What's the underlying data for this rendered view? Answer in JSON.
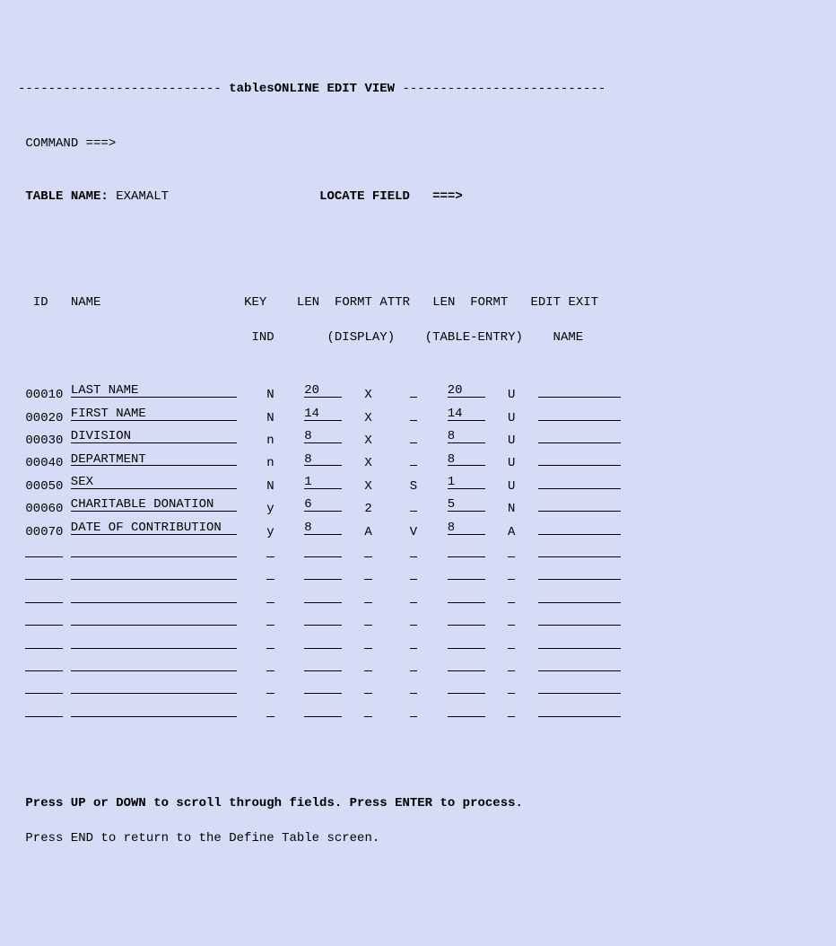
{
  "title_dashes_left": "--------------------------- ",
  "title": "tablesONLINE EDIT VIEW",
  "title_dashes_right": " ---------------------------",
  "command_label": "COMMAND ===>",
  "command_value": "",
  "table_name_label": "TABLE NAME:",
  "table_name_value": "EXAMALT",
  "locate_label": "LOCATE FIELD",
  "locate_arrow": "===>",
  "locate_value": "",
  "headers": {
    "id": "ID",
    "name": "NAME",
    "key": "KEY",
    "ind": "IND",
    "len1": "LEN",
    "formt1": "FORMT",
    "attr": "ATTR",
    "display": "(DISPLAY)",
    "len2": "LEN",
    "formt2": "FORMT",
    "table_entry": "(TABLE-ENTRY)",
    "edit_exit": "EDIT EXIT",
    "edit_name": "NAME"
  },
  "rows": [
    {
      "id": "00010",
      "name": "LAST NAME",
      "key": "N",
      "len1": "20",
      "formt1": "X",
      "attr": "",
      "len2": "20",
      "formt2": "U",
      "edit": ""
    },
    {
      "id": "00020",
      "name": "FIRST NAME",
      "key": "N",
      "len1": "14",
      "formt1": "X",
      "attr": "",
      "len2": "14",
      "formt2": "U",
      "edit": ""
    },
    {
      "id": "00030",
      "name": "DIVISION",
      "key": "n",
      "len1": "8",
      "formt1": "X",
      "attr": "",
      "len2": "8",
      "formt2": "U",
      "edit": ""
    },
    {
      "id": "00040",
      "name": "DEPARTMENT",
      "key": "n",
      "len1": "8",
      "formt1": "X",
      "attr": "",
      "len2": "8",
      "formt2": "U",
      "edit": ""
    },
    {
      "id": "00050",
      "name": "SEX",
      "key": "N",
      "len1": "1",
      "formt1": "X",
      "attr": "S",
      "len2": "1",
      "formt2": "U",
      "edit": ""
    },
    {
      "id": "00060",
      "name": "CHARITABLE DONATION",
      "key": "y",
      "len1": "6",
      "formt1": "2",
      "attr": "",
      "len2": "5",
      "formt2": "N",
      "edit": ""
    },
    {
      "id": "00070",
      "name": "DATE OF CONTRIBUTION",
      "key": "y",
      "len1": "8",
      "formt1": "A",
      "attr": "V",
      "len2": "8",
      "formt2": "A",
      "edit": ""
    },
    {
      "id": "",
      "name": "",
      "key": "",
      "len1": "",
      "formt1": "",
      "attr": "",
      "len2": "",
      "formt2": "",
      "edit": ""
    },
    {
      "id": "",
      "name": "",
      "key": "",
      "len1": "",
      "formt1": "",
      "attr": "",
      "len2": "",
      "formt2": "",
      "edit": ""
    },
    {
      "id": "",
      "name": "",
      "key": "",
      "len1": "",
      "formt1": "",
      "attr": "",
      "len2": "",
      "formt2": "",
      "edit": ""
    },
    {
      "id": "",
      "name": "",
      "key": "",
      "len1": "",
      "formt1": "",
      "attr": "",
      "len2": "",
      "formt2": "",
      "edit": ""
    },
    {
      "id": "",
      "name": "",
      "key": "",
      "len1": "",
      "formt1": "",
      "attr": "",
      "len2": "",
      "formt2": "",
      "edit": ""
    },
    {
      "id": "",
      "name": "",
      "key": "",
      "len1": "",
      "formt1": "",
      "attr": "",
      "len2": "",
      "formt2": "",
      "edit": ""
    },
    {
      "id": "",
      "name": "",
      "key": "",
      "len1": "",
      "formt1": "",
      "attr": "",
      "len2": "",
      "formt2": "",
      "edit": ""
    },
    {
      "id": "",
      "name": "",
      "key": "",
      "len1": "",
      "formt1": "",
      "attr": "",
      "len2": "",
      "formt2": "",
      "edit": ""
    }
  ],
  "footer1": "Press UP or DOWN to scroll through fields. Press ENTER to process.",
  "footer2": "Press END to return to the Define Table screen."
}
